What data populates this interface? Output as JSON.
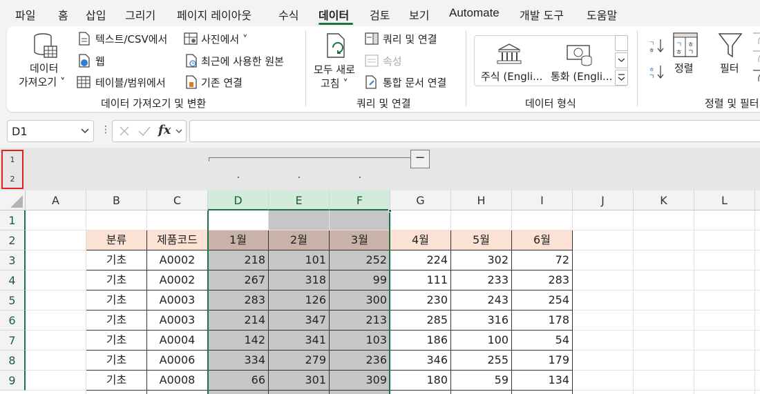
{
  "tabs": [
    {
      "label": "파일"
    },
    {
      "label": "홈"
    },
    {
      "label": "삽입"
    },
    {
      "label": "그리기"
    },
    {
      "label": "페이지 레이아웃"
    },
    {
      "label": "수식"
    },
    {
      "label": "데이터",
      "active": true
    },
    {
      "label": "검토"
    },
    {
      "label": "보기"
    },
    {
      "label": "Automate"
    },
    {
      "label": "개발 도구"
    },
    {
      "label": "도움말"
    }
  ],
  "ribbon": {
    "get_data": {
      "line1": "데이터",
      "line2": "가져오기 ˅"
    },
    "from_text_csv": "텍스트/CSV에서",
    "web": "웹",
    "from_table": "테이블/범위에서",
    "from_picture": "사진에서 ˅",
    "recent_sources": "최근에 사용한 원본",
    "existing_connections": "기존 연결",
    "group1_label": "데이터 가져오기 및 변환",
    "refresh_all": {
      "line1": "모두 새로",
      "line2": "고침 ˅"
    },
    "queries_connections": "쿼리 및 연결",
    "properties": "속성",
    "edit_links": "통합 문서 연결",
    "group2_label": "쿼리 및 연결",
    "stocks": "주식 (Engli...",
    "currencies": "통화 (Engli...",
    "group3_label": "데이터 형식",
    "sort": "정렬",
    "filter": "필터",
    "group4_label": "정렬 및 필터"
  },
  "formula_bar": {
    "name_box": "D1",
    "fx": "fx",
    "formula": ""
  },
  "outline": {
    "levels": [
      "1",
      "2"
    ],
    "collapse": "−"
  },
  "grid": {
    "columns": [
      "A",
      "B",
      "C",
      "D",
      "E",
      "F",
      "G",
      "H",
      "I",
      "J",
      "K",
      "L"
    ],
    "rows": [
      "1",
      "2",
      "3",
      "4",
      "5",
      "6",
      "7",
      "8",
      "9"
    ],
    "headers": [
      "분류",
      "제품코드",
      "1월",
      "2월",
      "3월",
      "4월",
      "5월",
      "6월"
    ],
    "data": [
      [
        "기초",
        "A0002",
        "218",
        "101",
        "252",
        "224",
        "302",
        "72"
      ],
      [
        "기초",
        "A0002",
        "267",
        "318",
        "99",
        "111",
        "233",
        "283"
      ],
      [
        "기초",
        "A0003",
        "283",
        "126",
        "300",
        "230",
        "243",
        "254"
      ],
      [
        "기초",
        "A0003",
        "214",
        "347",
        "213",
        "285",
        "316",
        "178"
      ],
      [
        "기초",
        "A0004",
        "142",
        "341",
        "103",
        "186",
        "100",
        "54"
      ],
      [
        "기초",
        "A0006",
        "334",
        "279",
        "236",
        "346",
        "255",
        "179"
      ],
      [
        "기초",
        "A0008",
        "66",
        "301",
        "309",
        "180",
        "59",
        "134"
      ]
    ]
  },
  "colors": {
    "accent": "#1e7145",
    "header_peach": "#fbe2d5",
    "header_gray": "#c9b3a9",
    "grouped_gray": "#c6c6c6",
    "level_highlight": "#e02020"
  }
}
